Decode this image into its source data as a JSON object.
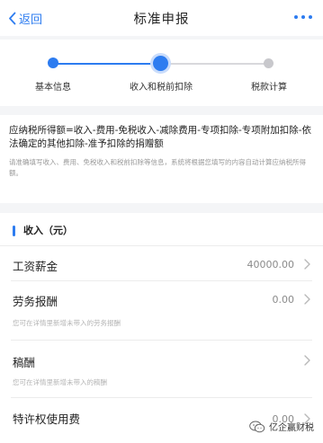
{
  "nav": {
    "back_label": "返回",
    "title": "标准申报",
    "more_icon": "more-dots-icon"
  },
  "steps": [
    {
      "label": "基本信息",
      "state": "done"
    },
    {
      "label": "收入和税前扣除",
      "state": "current"
    },
    {
      "label": "税款计算",
      "state": "todo"
    }
  ],
  "formula": {
    "main": "应纳税所得额=收入-费用-免税收入-减除费用-专项扣除-专项附加扣除-依法确定的其他扣除-准予扣除的捐赠额",
    "note": "请准确填写收入、费用、免税收入和税前扣除等信息，系统将根据您填写的内容自动计算应纳税所得额。"
  },
  "income_section": {
    "title": "收入（元）",
    "rows": [
      {
        "label": "工资薪金",
        "value": "40000.00",
        "hint": ""
      },
      {
        "label": "劳务报酬",
        "value": "0.00",
        "hint": "您可在详情里新增未带入的劳务报酬"
      },
      {
        "label": "稿酬",
        "value": "",
        "hint": "您可在详情里新增未带入的稿酬"
      },
      {
        "label": "特许权使用费",
        "value": "0.00",
        "hint": ""
      }
    ]
  },
  "watermark": {
    "text": "亿企赢财税",
    "icon": "wechat-icon"
  },
  "colors": {
    "accent": "#2d7cf0",
    "inactive": "#c8c8cc",
    "background": "#f4f5f7"
  }
}
